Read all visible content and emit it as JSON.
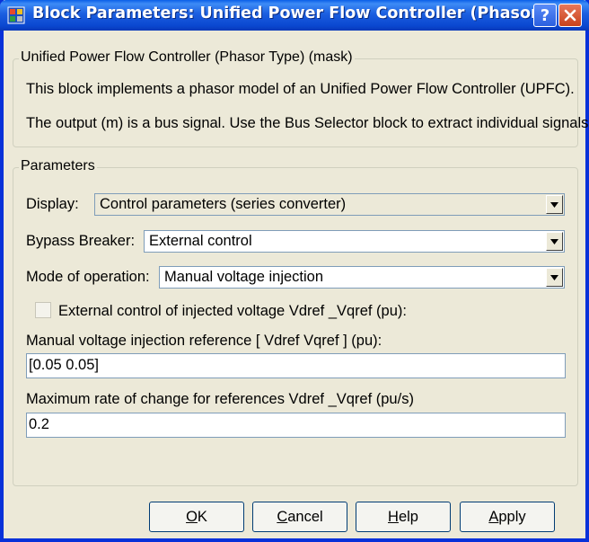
{
  "window": {
    "title": "Block Parameters: Unified Power Flow Controller (Phasor..."
  },
  "description_group": {
    "legend": "Unified Power Flow Controller (Phasor Type) (mask)",
    "line1": "This block implements a phasor model of an Unified Power Flow Controller (UPFC).",
    "line2": "The output (m) is a bus signal. Use the Bus Selector block to extract individual signals."
  },
  "parameters_group": {
    "legend": "Parameters",
    "display": {
      "label": "Display:",
      "value": "Control parameters (series converter)"
    },
    "bypass": {
      "label": "Bypass Breaker:",
      "value": "External control"
    },
    "mode": {
      "label": "Mode of operation:",
      "value": "Manual voltage injection"
    },
    "ext_control": {
      "label": "External control of injected voltage Vdref _Vqref (pu):",
      "checked": false
    },
    "vref": {
      "label": "Manual voltage injection reference [ Vdref  Vqref ] (pu):",
      "value": "[0.05 0.05]"
    },
    "rate": {
      "label": "Maximum rate of change for references Vdref _Vqref (pu/s)",
      "value": "0.2"
    }
  },
  "buttons": {
    "ok": {
      "mnemonic": "O",
      "rest": "K"
    },
    "cancel": {
      "mnemonic": "C",
      "rest": "ancel"
    },
    "help": {
      "mnemonic": "H",
      "rest": "elp"
    },
    "apply": {
      "mnemonic": "A",
      "rest": "pply"
    }
  },
  "colors": {
    "titlebar": "#0a47d0",
    "dialog_bg": "#ece9d8",
    "close_button": "#c8421c"
  },
  "icons": [
    "simulink-block-icon",
    "help-icon",
    "close-icon",
    "chevron-down-icon"
  ]
}
